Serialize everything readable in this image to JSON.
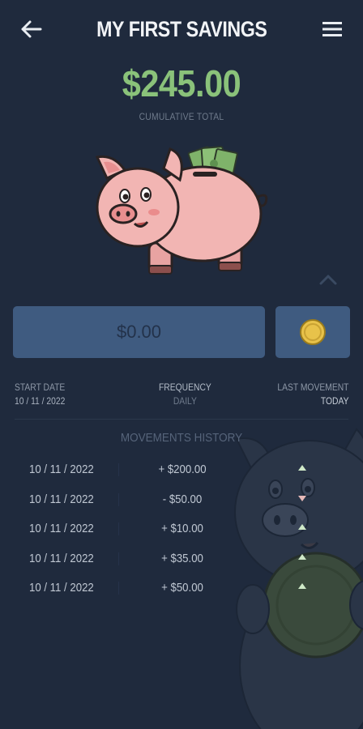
{
  "header": {
    "title": "MY FIRST SAVINGS",
    "back_icon": "arrow-left-icon",
    "menu_icon": "hamburger-menu-icon"
  },
  "summary": {
    "total": "$245.00",
    "caption": "CUMULATIVE TOTAL"
  },
  "deposit": {
    "placeholder": "$0.00",
    "coin_icon": "coin-icon"
  },
  "info": {
    "start_date_label": "START DATE",
    "start_date": "10 / 11 / 2022",
    "frequency_label": "FREQUENCY",
    "frequency": "DAILY",
    "last_movement_label": "LAST MOVEMENT",
    "last_movement": "TODAY"
  },
  "history": {
    "title": "MOVEMENTS HISTORY",
    "rows": [
      {
        "date": "10 / 11 / 2022",
        "amount": "+ $200.00",
        "direction": "up"
      },
      {
        "date": "10 / 11 / 2022",
        "amount": "- $50.00",
        "direction": "down"
      },
      {
        "date": "10 / 11 / 2022",
        "amount": "+ $10.00",
        "direction": "up"
      },
      {
        "date": "10 / 11 / 2022",
        "amount": "+ $35.00",
        "direction": "up"
      },
      {
        "date": "10 / 11 / 2022",
        "amount": "+ $50.00",
        "direction": "up"
      }
    ]
  },
  "colors": {
    "background": "#1f2a3d",
    "accent_green": "#8ac27a",
    "input_blue": "#3f5b80",
    "coin_gold": "#e8c24a",
    "pig_pink": "#f2b5b3"
  }
}
